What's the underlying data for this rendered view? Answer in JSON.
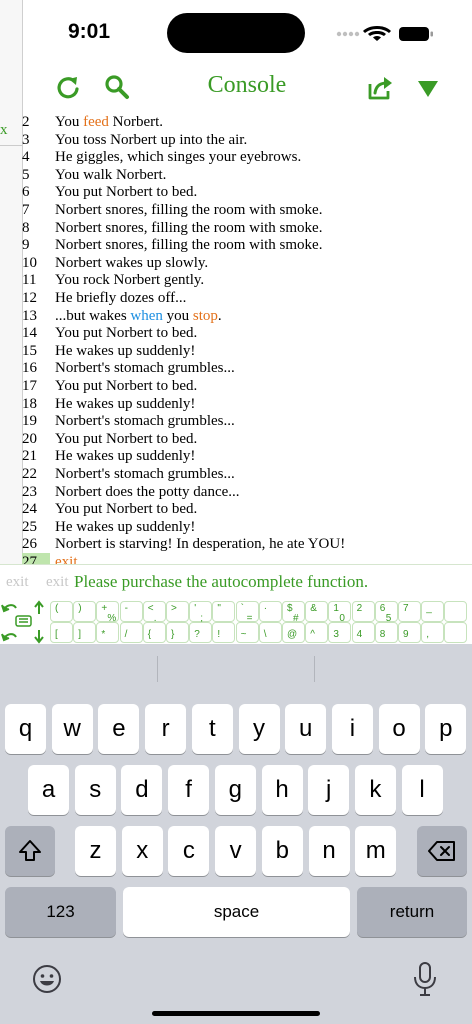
{
  "status": {
    "time": "9:01"
  },
  "nav": {
    "title": "Console"
  },
  "sidebar": {
    "close_glyph": "x"
  },
  "colors": {
    "accent": "#3a9b26",
    "keyword_orange": "#e3711a",
    "keyword_blue": "#1d8fe1"
  },
  "console": {
    "lines": [
      {
        "n": "2",
        "segs": [
          [
            "You ",
            ""
          ],
          [
            "feed",
            "orange"
          ],
          [
            " Norbert.",
            ""
          ]
        ]
      },
      {
        "n": "3",
        "segs": [
          [
            "You toss Norbert up into the air.",
            ""
          ]
        ]
      },
      {
        "n": "4",
        "segs": [
          [
            "He giggles, which singes your eyebrows.",
            ""
          ]
        ]
      },
      {
        "n": "5",
        "segs": [
          [
            "You walk Norbert.",
            ""
          ]
        ]
      },
      {
        "n": "6",
        "segs": [
          [
            "You put Norbert to bed.",
            ""
          ]
        ]
      },
      {
        "n": "7",
        "segs": [
          [
            "Norbert snores, filling the room with smoke.",
            ""
          ]
        ]
      },
      {
        "n": "8",
        "segs": [
          [
            "Norbert snores, filling the room with smoke.",
            ""
          ]
        ]
      },
      {
        "n": "9",
        "segs": [
          [
            "Norbert snores, filling the room with smoke.",
            ""
          ]
        ]
      },
      {
        "n": "10",
        "segs": [
          [
            "Norbert wakes up slowly.",
            ""
          ]
        ]
      },
      {
        "n": "11",
        "segs": [
          [
            "You rock Norbert gently.",
            ""
          ]
        ]
      },
      {
        "n": "12",
        "segs": [
          [
            "He briefly dozes off...",
            ""
          ]
        ]
      },
      {
        "n": "13",
        "segs": [
          [
            "...but wakes ",
            ""
          ],
          [
            "when",
            "blue"
          ],
          [
            " you ",
            ""
          ],
          [
            "stop",
            "orange"
          ],
          [
            ".",
            ""
          ]
        ]
      },
      {
        "n": "14",
        "segs": [
          [
            "You put Norbert to bed.",
            ""
          ]
        ]
      },
      {
        "n": "15",
        "segs": [
          [
            "He wakes up suddenly!",
            ""
          ]
        ]
      },
      {
        "n": "16",
        "segs": [
          [
            "Norbert's stomach grumbles...",
            ""
          ]
        ]
      },
      {
        "n": "17",
        "segs": [
          [
            "You put Norbert to bed.",
            ""
          ]
        ]
      },
      {
        "n": "18",
        "segs": [
          [
            "He wakes up suddenly!",
            ""
          ]
        ]
      },
      {
        "n": "19",
        "segs": [
          [
            "Norbert's stomach grumbles...",
            ""
          ]
        ]
      },
      {
        "n": "20",
        "segs": [
          [
            "You put Norbert to bed.",
            ""
          ]
        ]
      },
      {
        "n": "21",
        "segs": [
          [
            "He wakes up suddenly!",
            ""
          ]
        ]
      },
      {
        "n": "22",
        "segs": [
          [
            "Norbert's stomach grumbles...",
            ""
          ]
        ]
      },
      {
        "n": "23",
        "segs": [
          [
            "Norbert does the potty dance...",
            ""
          ]
        ]
      },
      {
        "n": "24",
        "segs": [
          [
            "You put Norbert to bed.",
            ""
          ]
        ]
      },
      {
        "n": "25",
        "segs": [
          [
            "He wakes up suddenly!",
            ""
          ]
        ]
      },
      {
        "n": "26",
        "segs": [
          [
            "Norbert is starving!  In desperation, he ate YOU!",
            ""
          ]
        ]
      }
    ],
    "current_line_number": "27",
    "current_line_text": "exit"
  },
  "input": {
    "ghost_1": "exit",
    "ghost_2": "exit",
    "message": "Please purchase the autocomplete function."
  },
  "keybar": {
    "cells": [
      {
        "top": "(",
        "bottom": "[",
        "mid": ""
      },
      {
        "top": ")",
        "bottom": "]",
        "mid": ""
      },
      {
        "top": "+",
        "bottom": "*",
        "mid": "%"
      },
      {
        "top": "-",
        "bottom": "/",
        "mid": ""
      },
      {
        "top": "<",
        "bottom": "{",
        "mid": "."
      },
      {
        "top": ">",
        "bottom": "}",
        "mid": ""
      },
      {
        "top": "'",
        "bottom": "?",
        "mid": ";"
      },
      {
        "top": "\"",
        "bottom": "!",
        "mid": ""
      },
      {
        "top": "`",
        "bottom": "~",
        "mid": "="
      },
      {
        "top": "·",
        "bottom": "\\",
        "mid": ""
      },
      {
        "top": "$",
        "bottom": "@",
        "mid": "#"
      },
      {
        "top": "&",
        "bottom": "^",
        "mid": ""
      },
      {
        "top": "1",
        "bottom": "3",
        "mid": "0"
      },
      {
        "top": "2",
        "bottom": "4",
        "mid": ""
      },
      {
        "top": "6",
        "bottom": "8",
        "mid": "5"
      },
      {
        "top": "7",
        "bottom": "9",
        "mid": ""
      },
      {
        "top": "_",
        "bottom": ",",
        "mid": ""
      },
      {
        "top": "",
        "bottom": "",
        "mid": ""
      }
    ]
  },
  "keyboard": {
    "row1": [
      "q",
      "w",
      "e",
      "r",
      "t",
      "y",
      "u",
      "i",
      "o",
      "p"
    ],
    "row2": [
      "a",
      "s",
      "d",
      "f",
      "g",
      "h",
      "j",
      "k",
      "l"
    ],
    "row3": [
      "z",
      "x",
      "c",
      "v",
      "b",
      "n",
      "m"
    ],
    "numbers_label": "123",
    "space_label": "space",
    "return_label": "return"
  }
}
